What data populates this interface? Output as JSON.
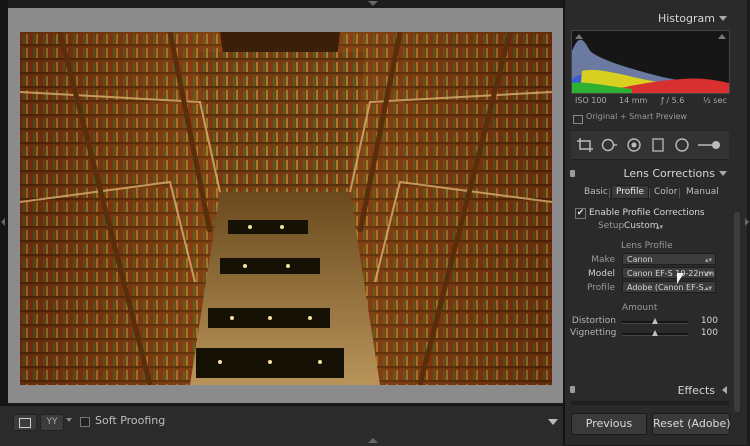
{
  "toolbar": {
    "soft_proofing_label": "Soft Proofing",
    "compare_icon_text": "YY"
  },
  "histogram": {
    "title": "Histogram",
    "iso": "ISO 100",
    "focal_length": "14 mm",
    "aperture": "ƒ / 5.6",
    "shutter": "½ sec",
    "smart_preview": "Original + Smart Preview"
  },
  "lens_corrections": {
    "title": "Lens Corrections",
    "tabs": [
      "Basic",
      "Profile",
      "Color",
      "Manual"
    ],
    "active_tab": "Profile",
    "enable_label": "Enable Profile Corrections",
    "enable_checked": true,
    "setup_label": "Setup",
    "setup_value": "Custom",
    "lens_profile_title": "Lens Profile",
    "make_label": "Make",
    "make_value": "Canon",
    "model_label": "Model",
    "model_value": "Canon EF-S 10-22mm...",
    "profile_label": "Profile",
    "profile_value": "Adobe (Canon EF-S...",
    "amount_title": "Amount",
    "distortion_label": "Distortion",
    "distortion_value": "100",
    "distortion_level": 0.5,
    "vignetting_label": "Vignetting",
    "vignetting_value": "100",
    "vignetting_level": 0.5
  },
  "effects": {
    "title": "Effects"
  },
  "buttons": {
    "previous": "Previous",
    "reset": "Reset (Adobe)"
  },
  "icons": {
    "checkmark": "✔",
    "dropdown": "▴▾"
  },
  "colors": {
    "panel_bg": "#2a2a2a",
    "canvas_bg": "#8b8b8b",
    "app_bg": "#1c1c1c"
  }
}
